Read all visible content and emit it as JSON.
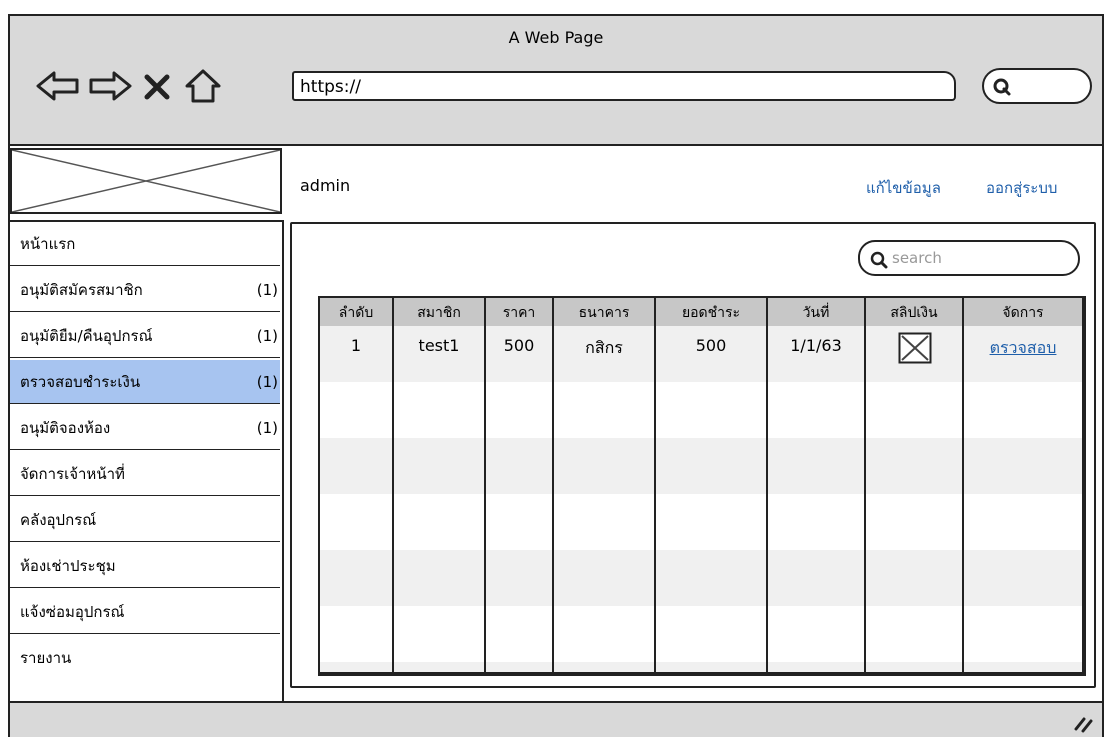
{
  "window": {
    "title": "A Web Page"
  },
  "browser": {
    "url": "https://"
  },
  "header": {
    "user": "admin",
    "edit_profile": "แก้ไขข้อมูล",
    "logout": "ออกสู่ระบบ"
  },
  "sidebar": {
    "items": [
      {
        "label": "หน้าแรก",
        "count": ""
      },
      {
        "label": "อนุมัติสมัครสมาชิก",
        "count": "(1)"
      },
      {
        "label": "อนุมัติยืม/คืนอุปกรณ์",
        "count": "(1)"
      },
      {
        "label": "ตรวจสอบชำระเงิน",
        "count": "(1)"
      },
      {
        "label": "อนุมัติจองห้อง",
        "count": "(1)"
      },
      {
        "label": "จัดการเจ้าหน้าที่",
        "count": ""
      },
      {
        "label": "คลังอุปกรณ์",
        "count": ""
      },
      {
        "label": "ห้องเช่าประชุม",
        "count": ""
      },
      {
        "label": "แจ้งซ่อมอุปกรณ์",
        "count": ""
      },
      {
        "label": "รายงาน",
        "count": ""
      }
    ]
  },
  "search": {
    "placeholder": "search"
  },
  "table": {
    "columns": [
      "ลำดับ",
      "สมาชิก",
      "ราคา",
      "ธนาคาร",
      "ยอดชำระ",
      "วันที่",
      "สลิปเงิน",
      "จัดการ"
    ],
    "rows": [
      {
        "no": "1",
        "member": "test1",
        "price": "500",
        "bank": "กสิกร",
        "amount": "500",
        "date": "1/1/63",
        "action": "ตรวจสอบ"
      }
    ]
  },
  "colors": {
    "chrome": "#d9d9d9",
    "active": "#a7c4f0",
    "link": "#1f5faa"
  }
}
